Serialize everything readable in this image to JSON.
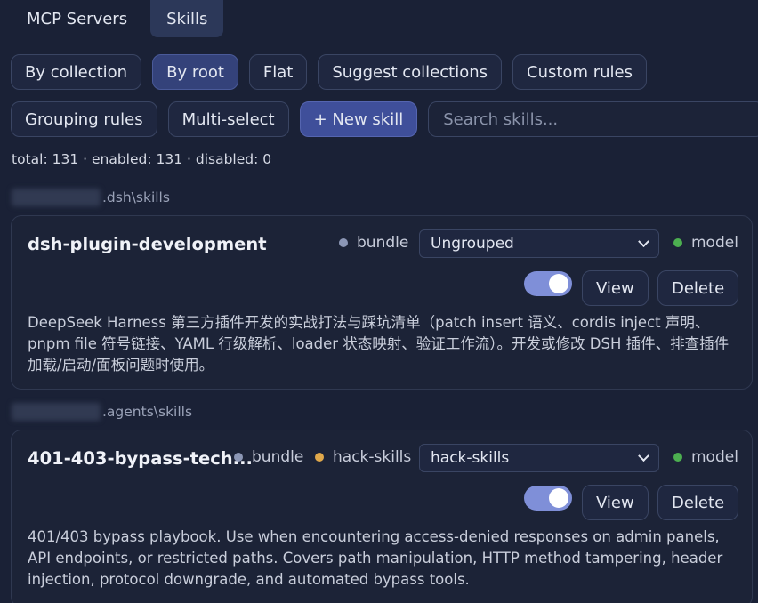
{
  "tabs": [
    {
      "label": "MCP Servers",
      "active": false
    },
    {
      "label": "Skills",
      "active": true
    }
  ],
  "view_modes": {
    "by_collection": "By collection",
    "by_root": "By root",
    "flat": "Flat",
    "suggest_collections": "Suggest collections",
    "custom_rules": "Custom rules"
  },
  "toolbar": {
    "grouping_rules": "Grouping rules",
    "multi_select": "Multi-select",
    "new_skill": "+ New skill",
    "search_placeholder": "Search skills..."
  },
  "stats": "total: 131 · enabled: 131 · disabled: 0",
  "groups": [
    {
      "path_suffix": ".dsh\\skills",
      "skill": {
        "name": "dsh-plugin-development",
        "tags": [
          "bundle"
        ],
        "collection": "Ungrouped",
        "model_label": "model",
        "enabled": true,
        "view_label": "View",
        "delete_label": "Delete",
        "description": "DeepSeek Harness 第三方插件开发的实战打法与踩坑清单（patch insert 语义、cordis inject 声明、pnpm file 符号链接、YAML 行级解析、loader 状态映射、验证工作流）。开发或修改 DSH 插件、排查插件加载/启动/面板问题时使用。"
      }
    },
    {
      "path_suffix": ".agents\\skills",
      "skill": {
        "name": "401-403-bypass-tech...",
        "tags": [
          "bundle",
          "hack-skills"
        ],
        "collection": "hack-skills",
        "model_label": "model",
        "enabled": true,
        "view_label": "View",
        "delete_label": "Delete",
        "description": "401/403 bypass playbook. Use when encountering access-denied responses on admin panels, API endpoints, or restricted paths. Covers path manipulation, HTTP method tampering, header injection, protocol downgrade, and automated bypass tools."
      }
    }
  ],
  "colors": {
    "bundle_dot": "#8b96b5",
    "hack_skills_dot": "#e0a84b",
    "model_dot": "#4caf50",
    "accent": "#3f4f9a",
    "toggle_on": "#7f8fd8"
  }
}
